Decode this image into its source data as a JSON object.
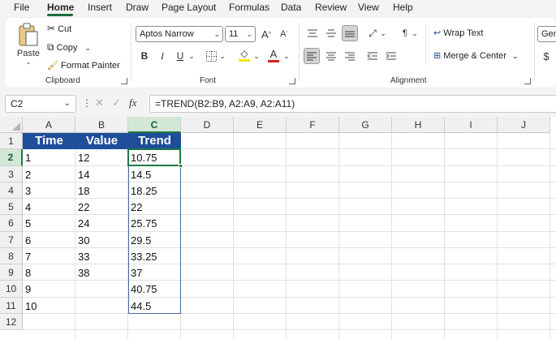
{
  "menu": {
    "tabs": [
      "File",
      "Home",
      "Insert",
      "Draw",
      "Page Layout",
      "Formulas",
      "Data",
      "Review",
      "View",
      "Help"
    ],
    "active": "Home"
  },
  "ribbon": {
    "clipboard": {
      "paste_label": "Paste",
      "cut_label": "Cut",
      "copy_label": "Copy",
      "format_painter_label": "Format Painter",
      "group_label": "Clipboard"
    },
    "font": {
      "font_name": "Aptos Narrow",
      "font_size": "11",
      "group_label": "Font",
      "bold": "B",
      "italic": "I",
      "underline": "U",
      "grow": "A",
      "shrink": "A",
      "font_color_letter": "A"
    },
    "alignment": {
      "wrap_text_label": "Wrap Text",
      "merge_center_label": "Merge & Center",
      "group_label": "Alignment"
    },
    "number": {
      "format_value": "Gen",
      "currency_symbol": "$"
    }
  },
  "formula_bar": {
    "name_box": "C2",
    "fx_label": "fx",
    "formula": "=TREND(B2:B9, A2:A9, A2:A11)"
  },
  "sheet": {
    "columns": [
      "A",
      "B",
      "C",
      "D",
      "E",
      "F",
      "G",
      "H",
      "I",
      "J"
    ],
    "rows": [
      "1",
      "2",
      "3",
      "4",
      "5",
      "6",
      "7",
      "8",
      "9",
      "10",
      "11",
      "12"
    ],
    "selected_column": "C",
    "selected_row": "2",
    "header_row": [
      "Time",
      "Value",
      "Trend"
    ],
    "data": [
      [
        "1",
        "12",
        "10.75"
      ],
      [
        "2",
        "14",
        "14.5"
      ],
      [
        "3",
        "18",
        "18.25"
      ],
      [
        "4",
        "22",
        "22"
      ],
      [
        "5",
        "24",
        "25.75"
      ],
      [
        "6",
        "30",
        "29.5"
      ],
      [
        "7",
        "33",
        "33.25"
      ],
      [
        "8",
        "38",
        "37"
      ],
      [
        "9",
        "",
        "40.75"
      ],
      [
        "10",
        "",
        "44.5"
      ]
    ],
    "header_color": "#1f4e9a",
    "accent_color": "#1f7a45"
  }
}
